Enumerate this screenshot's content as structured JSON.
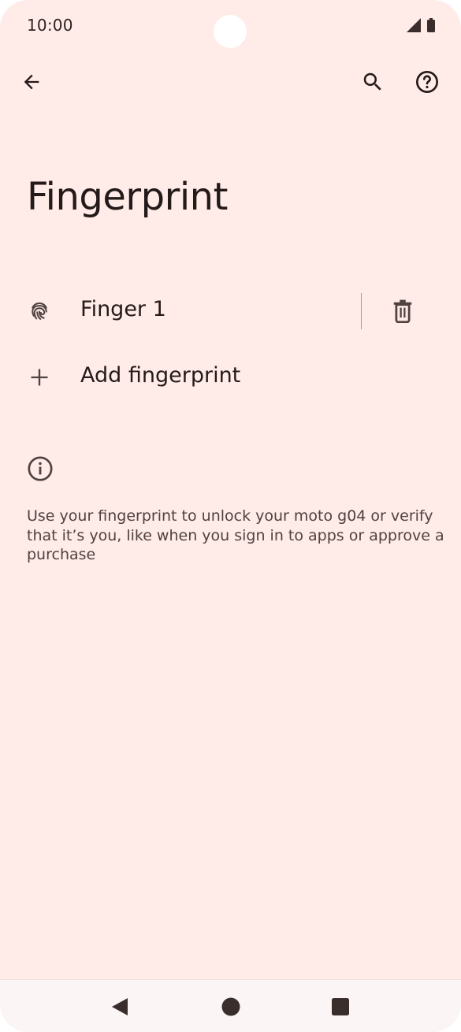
{
  "status_bar": {
    "time": "10:00",
    "icons": [
      "signal-icon",
      "battery-icon"
    ]
  },
  "toolbar": {
    "back_icon": "arrow-back-icon",
    "search_icon": "search-icon",
    "help_icon": "help-icon"
  },
  "page": {
    "title": "Fingerprint"
  },
  "fingerprints": [
    {
      "label": "Finger 1",
      "icon": "fingerprint-icon",
      "action_icon": "trash-icon"
    }
  ],
  "add_fingerprint": {
    "label": "Add fingerprint",
    "icon": "plus-icon"
  },
  "info": {
    "icon": "info-icon",
    "text": "Use your fingerprint to unlock your moto g04 or verify that it’s you, like when you sign in to apps or approve a purchase"
  },
  "nav_bar": {
    "buttons": [
      "back-triangle-icon",
      "home-circle-icon",
      "recents-square-icon"
    ]
  },
  "colors": {
    "background": "#ffebe8",
    "text_primary": "#231a19",
    "text_secondary": "#4f4240",
    "nav_background": "#fbf5f5"
  }
}
